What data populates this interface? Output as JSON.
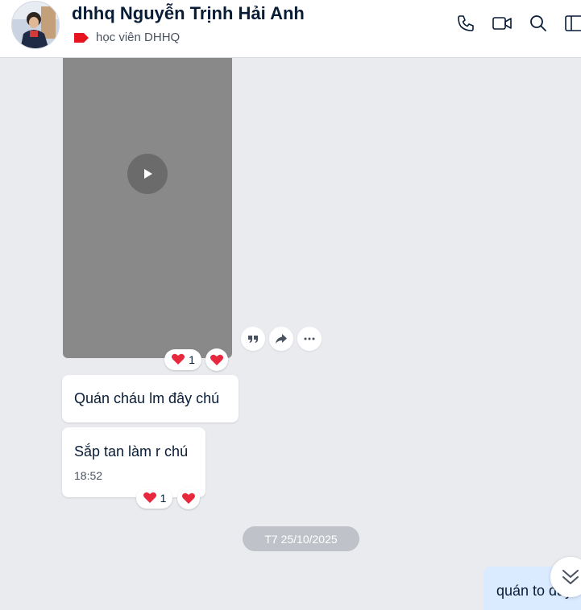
{
  "header": {
    "title": "dhhq Nguyễn Trịnh Hải Anh",
    "tag_label": "học viên DHHQ",
    "tag_color": "#e5141f",
    "icons": [
      "phone-icon",
      "video-call-icon",
      "search-icon",
      "sidebar-toggle-icon"
    ]
  },
  "messages": {
    "video_reaction": {
      "emoji": "❤️",
      "count": "1",
      "quick_emoji": "❤️"
    },
    "action_icons": [
      "quote-icon",
      "share-icon",
      "more-icon"
    ],
    "bubble1": {
      "text": "Quán cháu lm đây chú"
    },
    "bubble2": {
      "text": "Sắp tan làm r chú",
      "time": "18:52",
      "reaction_emoji": "❤️",
      "reaction_count": "1",
      "quick_emoji": "❤️"
    }
  },
  "date_divider": "T7 25/10/2025",
  "outgoing": {
    "text": "quán to đấy"
  },
  "colors": {
    "background": "#e9ebef",
    "heart": "#e8283c",
    "outgoing_bubble": "#dbebff",
    "date_chip": "#bfc3c9"
  }
}
